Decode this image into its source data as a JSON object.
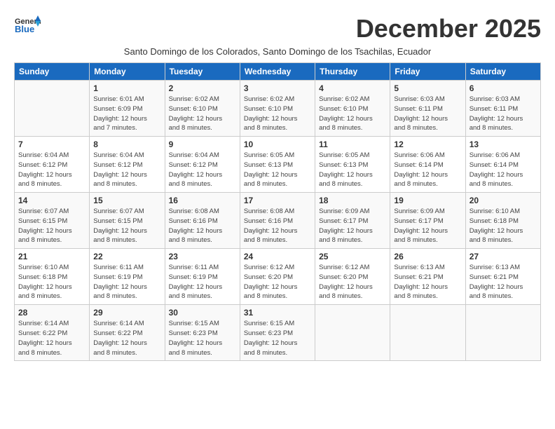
{
  "header": {
    "logo_line1": "General",
    "logo_line2": "Blue",
    "month": "December 2025",
    "subtitle": "Santo Domingo de los Colorados, Santo Domingo de los Tsachilas, Ecuador"
  },
  "weekdays": [
    "Sunday",
    "Monday",
    "Tuesday",
    "Wednesday",
    "Thursday",
    "Friday",
    "Saturday"
  ],
  "weeks": [
    [
      {
        "day": "",
        "info": ""
      },
      {
        "day": "1",
        "info": "Sunrise: 6:01 AM\nSunset: 6:09 PM\nDaylight: 12 hours\nand 7 minutes."
      },
      {
        "day": "2",
        "info": "Sunrise: 6:02 AM\nSunset: 6:10 PM\nDaylight: 12 hours\nand 8 minutes."
      },
      {
        "day": "3",
        "info": "Sunrise: 6:02 AM\nSunset: 6:10 PM\nDaylight: 12 hours\nand 8 minutes."
      },
      {
        "day": "4",
        "info": "Sunrise: 6:02 AM\nSunset: 6:10 PM\nDaylight: 12 hours\nand 8 minutes."
      },
      {
        "day": "5",
        "info": "Sunrise: 6:03 AM\nSunset: 6:11 PM\nDaylight: 12 hours\nand 8 minutes."
      },
      {
        "day": "6",
        "info": "Sunrise: 6:03 AM\nSunset: 6:11 PM\nDaylight: 12 hours\nand 8 minutes."
      }
    ],
    [
      {
        "day": "7",
        "info": "Sunrise: 6:04 AM\nSunset: 6:12 PM\nDaylight: 12 hours\nand 8 minutes."
      },
      {
        "day": "8",
        "info": "Sunrise: 6:04 AM\nSunset: 6:12 PM\nDaylight: 12 hours\nand 8 minutes."
      },
      {
        "day": "9",
        "info": "Sunrise: 6:04 AM\nSunset: 6:12 PM\nDaylight: 12 hours\nand 8 minutes."
      },
      {
        "day": "10",
        "info": "Sunrise: 6:05 AM\nSunset: 6:13 PM\nDaylight: 12 hours\nand 8 minutes."
      },
      {
        "day": "11",
        "info": "Sunrise: 6:05 AM\nSunset: 6:13 PM\nDaylight: 12 hours\nand 8 minutes."
      },
      {
        "day": "12",
        "info": "Sunrise: 6:06 AM\nSunset: 6:14 PM\nDaylight: 12 hours\nand 8 minutes."
      },
      {
        "day": "13",
        "info": "Sunrise: 6:06 AM\nSunset: 6:14 PM\nDaylight: 12 hours\nand 8 minutes."
      }
    ],
    [
      {
        "day": "14",
        "info": "Sunrise: 6:07 AM\nSunset: 6:15 PM\nDaylight: 12 hours\nand 8 minutes."
      },
      {
        "day": "15",
        "info": "Sunrise: 6:07 AM\nSunset: 6:15 PM\nDaylight: 12 hours\nand 8 minutes."
      },
      {
        "day": "16",
        "info": "Sunrise: 6:08 AM\nSunset: 6:16 PM\nDaylight: 12 hours\nand 8 minutes."
      },
      {
        "day": "17",
        "info": "Sunrise: 6:08 AM\nSunset: 6:16 PM\nDaylight: 12 hours\nand 8 minutes."
      },
      {
        "day": "18",
        "info": "Sunrise: 6:09 AM\nSunset: 6:17 PM\nDaylight: 12 hours\nand 8 minutes."
      },
      {
        "day": "19",
        "info": "Sunrise: 6:09 AM\nSunset: 6:17 PM\nDaylight: 12 hours\nand 8 minutes."
      },
      {
        "day": "20",
        "info": "Sunrise: 6:10 AM\nSunset: 6:18 PM\nDaylight: 12 hours\nand 8 minutes."
      }
    ],
    [
      {
        "day": "21",
        "info": "Sunrise: 6:10 AM\nSunset: 6:18 PM\nDaylight: 12 hours\nand 8 minutes."
      },
      {
        "day": "22",
        "info": "Sunrise: 6:11 AM\nSunset: 6:19 PM\nDaylight: 12 hours\nand 8 minutes."
      },
      {
        "day": "23",
        "info": "Sunrise: 6:11 AM\nSunset: 6:19 PM\nDaylight: 12 hours\nand 8 minutes."
      },
      {
        "day": "24",
        "info": "Sunrise: 6:12 AM\nSunset: 6:20 PM\nDaylight: 12 hours\nand 8 minutes."
      },
      {
        "day": "25",
        "info": "Sunrise: 6:12 AM\nSunset: 6:20 PM\nDaylight: 12 hours\nand 8 minutes."
      },
      {
        "day": "26",
        "info": "Sunrise: 6:13 AM\nSunset: 6:21 PM\nDaylight: 12 hours\nand 8 minutes."
      },
      {
        "day": "27",
        "info": "Sunrise: 6:13 AM\nSunset: 6:21 PM\nDaylight: 12 hours\nand 8 minutes."
      }
    ],
    [
      {
        "day": "28",
        "info": "Sunrise: 6:14 AM\nSunset: 6:22 PM\nDaylight: 12 hours\nand 8 minutes."
      },
      {
        "day": "29",
        "info": "Sunrise: 6:14 AM\nSunset: 6:22 PM\nDaylight: 12 hours\nand 8 minutes."
      },
      {
        "day": "30",
        "info": "Sunrise: 6:15 AM\nSunset: 6:23 PM\nDaylight: 12 hours\nand 8 minutes."
      },
      {
        "day": "31",
        "info": "Sunrise: 6:15 AM\nSunset: 6:23 PM\nDaylight: 12 hours\nand 8 minutes."
      },
      {
        "day": "",
        "info": ""
      },
      {
        "day": "",
        "info": ""
      },
      {
        "day": "",
        "info": ""
      }
    ]
  ]
}
